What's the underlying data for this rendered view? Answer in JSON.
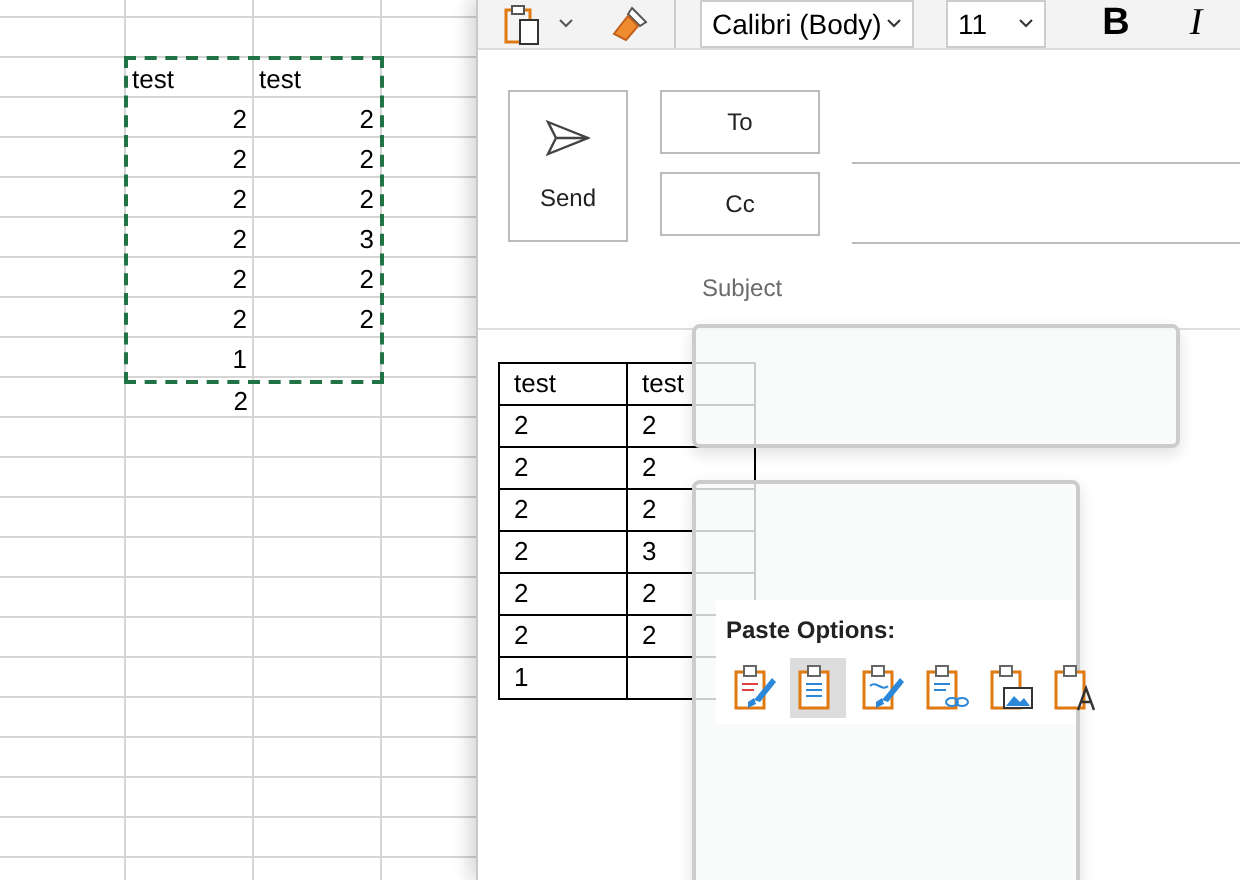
{
  "spreadsheet": {
    "copied_range": {
      "rows": [
        {
          "kind": "text",
          "cells": [
            "test",
            "test"
          ]
        },
        {
          "kind": "number",
          "cells": [
            "2",
            "2"
          ]
        },
        {
          "kind": "number",
          "cells": [
            "2",
            "2"
          ]
        },
        {
          "kind": "number",
          "cells": [
            "2",
            "2"
          ]
        },
        {
          "kind": "number",
          "cells": [
            "2",
            "3"
          ]
        },
        {
          "kind": "number",
          "cells": [
            "2",
            "2"
          ]
        },
        {
          "kind": "number",
          "cells": [
            "2",
            "2"
          ]
        },
        {
          "kind": "number",
          "cells": [
            "1"
          ]
        }
      ]
    },
    "rows_below": [
      {
        "kind": "number",
        "cells": [
          "2"
        ]
      }
    ]
  },
  "ribbon": {
    "font": "Calibri (Body)",
    "size": "11",
    "bold": "B",
    "italic": "I"
  },
  "compose": {
    "send": "Send",
    "to": "To",
    "cc": "Cc",
    "subject": {
      "placeholder": "Subject"
    }
  },
  "body_table": {
    "rows": [
      [
        "test",
        "test"
      ],
      [
        "2",
        "2"
      ],
      [
        "2",
        "2"
      ],
      [
        "2",
        "2"
      ],
      [
        "2",
        "3"
      ],
      [
        "2",
        "2"
      ],
      [
        "2",
        "2"
      ],
      [
        "1"
      ]
    ]
  },
  "paste_options": {
    "title": "Paste Options:",
    "options": [
      {
        "kind": "keep-source",
        "selected": false
      },
      {
        "kind": "destination",
        "selected": true
      },
      {
        "kind": "merge",
        "selected": false
      },
      {
        "kind": "link",
        "selected": false
      },
      {
        "kind": "picture",
        "selected": false
      },
      {
        "kind": "text-only",
        "selected": false
      }
    ]
  }
}
